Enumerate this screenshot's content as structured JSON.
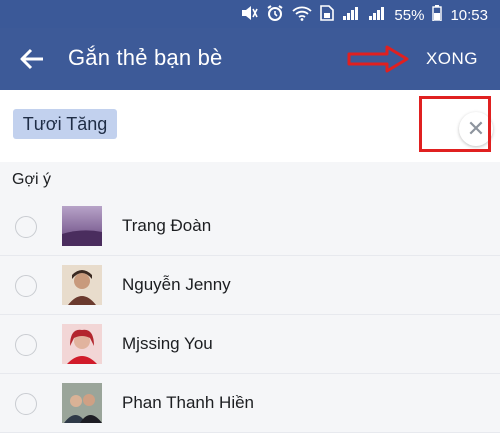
{
  "status_bar": {
    "battery": "55%",
    "time": "10:53"
  },
  "app_bar": {
    "title": "Gắn thẻ bạn bè",
    "done": "XONG"
  },
  "tag_chip": "Tươi Tăng",
  "clear_icon": "close-icon",
  "section_label": "Gợi ý",
  "friends": [
    {
      "name": "Trang Đoàn"
    },
    {
      "name": "Nguyễn Jenny"
    },
    {
      "name": "Mjssing You"
    },
    {
      "name": "Phan Thanh Hiền"
    }
  ],
  "colors": {
    "header": "#3d5a98",
    "annotation_red": "#e02020",
    "chip": "#c2d1ee"
  }
}
